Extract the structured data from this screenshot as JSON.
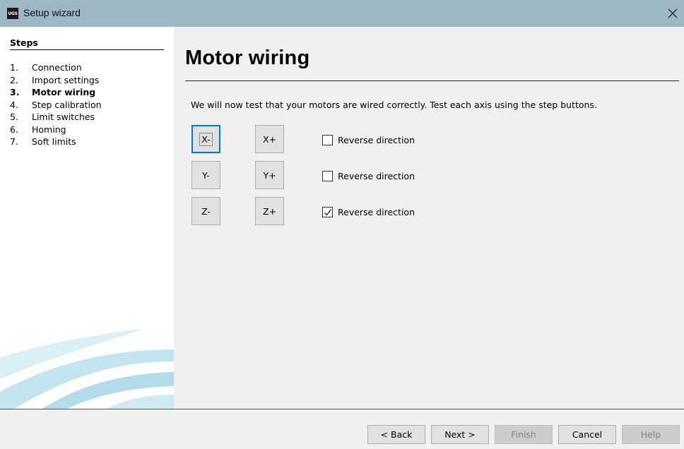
{
  "window": {
    "icon_text": "UGS",
    "title": "Setup wizard"
  },
  "steps": {
    "heading": "Steps",
    "items": [
      {
        "num": "1.",
        "label": "Connection",
        "current": false
      },
      {
        "num": "2.",
        "label": "Import settings",
        "current": false
      },
      {
        "num": "3.",
        "label": "Motor wiring",
        "current": true
      },
      {
        "num": "4.",
        "label": "Step calibration",
        "current": false
      },
      {
        "num": "5.",
        "label": "Limit switches",
        "current": false
      },
      {
        "num": "6.",
        "label": "Homing",
        "current": false
      },
      {
        "num": "7.",
        "label": "Soft limits",
        "current": false
      }
    ]
  },
  "main": {
    "title": "Motor wiring",
    "intro": "We will now test that your motors are wired correctly. Test each axis using the step buttons.",
    "axes": [
      {
        "minus": "X-",
        "plus": "X+",
        "reverse_label": "Reverse direction",
        "reverse_checked": false
      },
      {
        "minus": "Y-",
        "plus": "Y+",
        "reverse_label": "Reverse direction",
        "reverse_checked": false
      },
      {
        "minus": "Z-",
        "plus": "Z+",
        "reverse_label": "Reverse direction",
        "reverse_checked": true
      }
    ]
  },
  "footer": {
    "back": "< Back",
    "next": "Next >",
    "finish": "Finish",
    "cancel": "Cancel",
    "help": "Help"
  },
  "colors": {
    "titlebar": "#9db7c4",
    "focus": "#0078d7",
    "decor": "#bfe3ee"
  },
  "icons": [
    "ugs-app-icon",
    "close-icon",
    "checkmark-icon"
  ]
}
